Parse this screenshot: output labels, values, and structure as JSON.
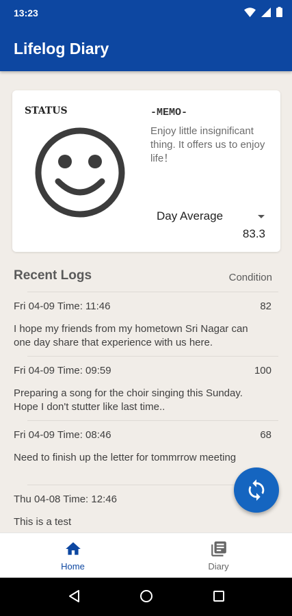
{
  "status_bar": {
    "time": "13:23"
  },
  "app_bar": {
    "title": "Lifelog Diary"
  },
  "status_card": {
    "status_label": "STATUS",
    "mood_icon": "smiley-face-icon",
    "memo_title": "-MEMO-",
    "memo_text": "Enjoy little insignificant thing. It offers us to enjoy life！",
    "average_selector": {
      "selected": "Day Average"
    },
    "average_value": "83.3"
  },
  "recent_logs": {
    "title": "Recent Logs",
    "condition_header": "Condition",
    "items": [
      {
        "date": "Fri 04-09 Time: 11:46",
        "condition": "82",
        "text": "I hope my friends from my hometown Sri Nagar can one day share that experience with us here."
      },
      {
        "date": "Fri 04-09 Time: 09:59",
        "condition": "100",
        "text": "Preparing a song for the choir singing this Sunday. Hope I don't stutter like last time.."
      },
      {
        "date": "Fri 04-09 Time: 08:46",
        "condition": "68",
        "text": "Need to finish up the letter for tommrrow meeting"
      },
      {
        "date": "Thu 04-08 Time: 12:46",
        "condition": "",
        "text": "This is a test"
      }
    ]
  },
  "fab": {
    "icon": "refresh-icon"
  },
  "bottom_nav": {
    "items": [
      {
        "label": "Home",
        "icon": "home-icon",
        "active": true
      },
      {
        "label": "Diary",
        "icon": "diary-icon",
        "active": false
      }
    ]
  },
  "colors": {
    "primary": "#0d47a1",
    "fab": "#1565c0",
    "background": "#f1ede8"
  }
}
